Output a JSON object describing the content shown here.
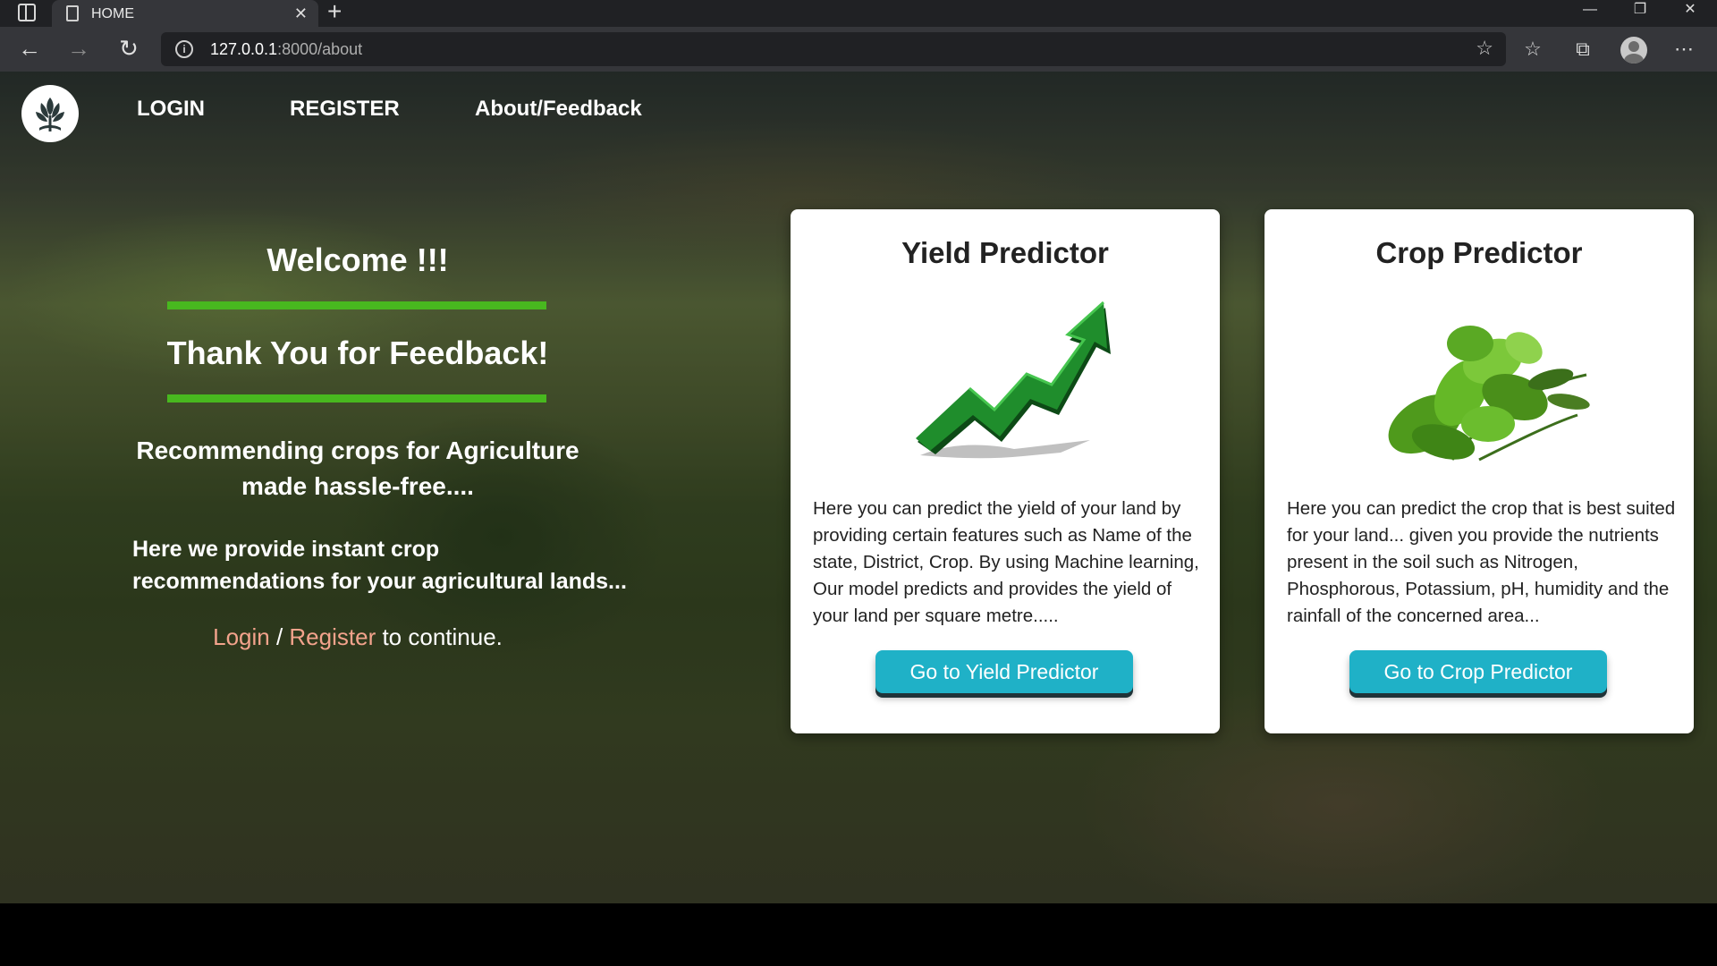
{
  "browser": {
    "tab_title": "HOME",
    "tab_close": "✕",
    "new_tab": "+",
    "url_host": "127.0.0.1",
    "url_rest": ":8000/about",
    "controls": {
      "minimize": "—",
      "restore": "❐",
      "close": "✕"
    },
    "icons": [
      "back-icon",
      "forward-icon",
      "refresh-icon",
      "info-icon",
      "favorite-add-icon",
      "favorites-icon",
      "collections-icon",
      "profile-icon",
      "more-icon"
    ]
  },
  "nav": {
    "links": [
      "LOGIN",
      "REGISTER",
      "About/Feedback"
    ]
  },
  "hero": {
    "welcome": "Welcome !!!",
    "thanks": "Thank You for Feedback!",
    "tagline": "Recommending crops for Agriculture made hassle-free....",
    "provide": "Here we provide instant crop recommendations for your agricultural lands...",
    "login_link": "Login",
    "separator": " / ",
    "register_link": "Register",
    "continue_text": " to continue."
  },
  "cards": [
    {
      "title": "Yield Predictor",
      "description": "Here you can predict the yield of your land by providing certain features such as Name of the state, District, Crop. By using Machine learning, Our model predicts and provides the yield of your land per square metre.....",
      "button": "Go to Yield Predictor",
      "image": "growth-arrow-image"
    },
    {
      "title": "Crop Predictor",
      "description": "Here you can predict the crop that is best suited for your land... given you provide the nutrients present in the soil such as Nitrogen, Phosphorous, Potassium, pH, humidity and the rainfall of the concerned area...",
      "button": "Go to Crop Predictor",
      "image": "herbs-image"
    }
  ],
  "colors": {
    "accent_bar": "#48b81f",
    "button": "#1fb1c7",
    "link": "#f3a38c"
  }
}
